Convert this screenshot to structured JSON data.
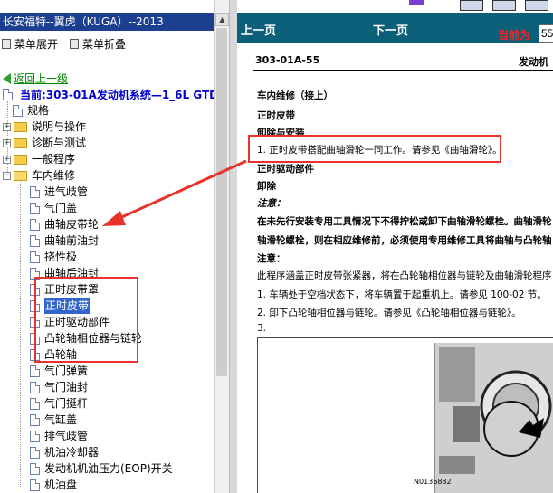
{
  "left": {
    "title": "长安福特--翼虎（KUGA）--2013",
    "toolbar": {
      "expand_all": "菜单展开",
      "collapse_all": "菜单折叠"
    },
    "back_link": "返回上一级",
    "current": "当前:303-01A发动机系统—1_6L GTDI",
    "tree": {
      "spec": "规格",
      "desc": "说明与操作",
      "diag": "诊断与测试",
      "general": "一般程序",
      "invehicle": "车内维修",
      "children": [
        "进气歧管",
        "气门盖",
        "曲轴皮带轮",
        "曲轴前油封",
        "挠性极",
        "曲轴后油封",
        "正时皮带罩",
        "正时皮带",
        "正时驱动部件",
        "凸轮轴相位器与链轮",
        "凸轮轴",
        "气门弹簧",
        "气门油封",
        "气门挺杆",
        "气缸盖",
        "排气歧管",
        "机油冷却器",
        "发动机机油压力(EOP)开关",
        "机油盘"
      ]
    }
  },
  "nav": {
    "prev": "上一页",
    "next": "下一页",
    "current_label": "当前为",
    "page_value": "55"
  },
  "doc": {
    "id": "303-01A-55",
    "section": "发动机",
    "lines": {
      "l1": "车内维修（接上）",
      "l2": "正时皮带",
      "l3": "卸除与安装",
      "l4": "1. 正时皮带搭配曲轴滑轮一同工作。请参见《曲轴滑轮》。",
      "l5": "正时驱动部件",
      "l6": "卸除",
      "l7": "注意：",
      "l8": "在未先行安装专用工具情况下不得拧松或卸下曲轴滑轮螺栓。曲轴滑轮",
      "l9": "轴滑轮螺栓，则在相应维修前，必须使用专用维修工具将曲轴与凸轮轴",
      "l10": "注意：",
      "l11": "此程序涵盖正时皮带张紧器，将在凸轮轴相位器与链轮及曲轴滑轮程序",
      "l12": "1. 车辆处于空档状态下，将车辆置于起重机上。请参见 100-02 节。",
      "l13": "2. 卸下凸轮轴相位器与链轮。请参见《凸轮轴相位器与链轮》。",
      "l14": "3."
    },
    "figure_label": "N0136882"
  },
  "colors": {
    "nav_bg": "#0b5f79",
    "title_bg": "#1d3f8f",
    "annotation": "#e8332c",
    "selected": "#3366cc"
  }
}
